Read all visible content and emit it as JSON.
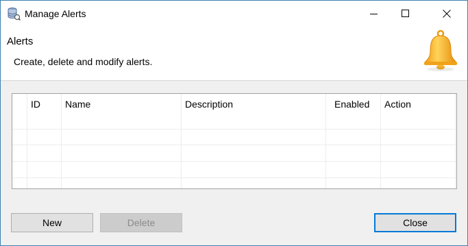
{
  "window": {
    "title": "Manage Alerts"
  },
  "banner": {
    "title": "Alerts",
    "description": "Create, delete and modify alerts."
  },
  "table": {
    "columns": [
      "",
      "ID",
      "Name",
      "Description",
      "Enabled",
      "Action"
    ],
    "rows": []
  },
  "buttons": {
    "new": "New",
    "delete": "Delete",
    "close": "Close"
  },
  "colors": {
    "window_border": "#3c7fb1",
    "dialog_bg": "#f0f0f0",
    "default_button_border": "#0078d7",
    "bell": "#f7b324"
  }
}
